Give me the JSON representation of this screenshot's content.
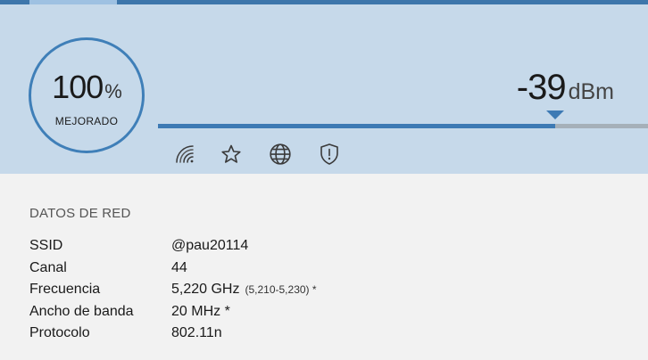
{
  "header": {
    "quality": {
      "value": "100",
      "unit": "%",
      "label": "MEJORADO"
    },
    "signal": {
      "value": "-39",
      "unit": "dBm",
      "level_fraction": 0.81
    },
    "icons": [
      "wifi-signal-icon",
      "star-icon",
      "globe-icon",
      "shield-icon"
    ]
  },
  "details": {
    "title": "DATOS DE RED",
    "rows": [
      {
        "label": "SSID",
        "value": "@pau20114",
        "extra": ""
      },
      {
        "label": "Canal",
        "value": "44",
        "extra": ""
      },
      {
        "label": "Frecuencia",
        "value": "5,220 GHz",
        "extra": "(5,210-5,230) *"
      },
      {
        "label": "Ancho de banda",
        "value": "20 MHz *",
        "extra": ""
      },
      {
        "label": "Protocolo",
        "value": "802.11n",
        "extra": ""
      }
    ]
  },
  "colors": {
    "accent": "#3d7ab4",
    "header_bg": "#c6d9ea",
    "page_bg": "#f2f2f2",
    "track": "#a5b0b9"
  }
}
